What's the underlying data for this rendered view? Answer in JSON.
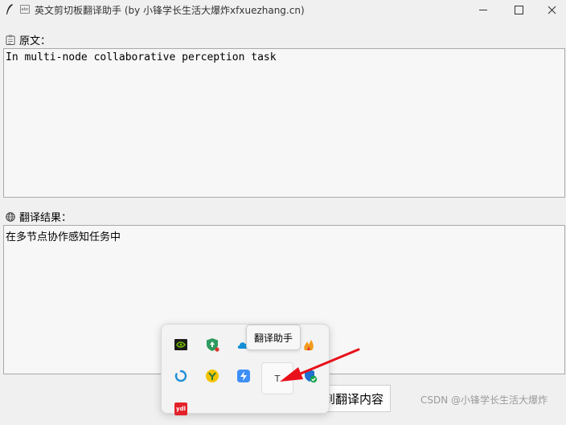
{
  "window": {
    "title": "英文剪切板翻译助手 (by 小锋学长生活大爆炸xfxuezhang.cn)",
    "title_icon_text": "abc"
  },
  "source": {
    "label": "原文：",
    "text": "In multi-node collaborative perception task"
  },
  "result": {
    "label": "翻译结果：",
    "text": "在多节点协作感知任务中"
  },
  "bottom_button": {
    "label": "到翻译内容"
  },
  "tray": {
    "tooltip": "翻译助手",
    "app_icon_letter": "T",
    "badge_text": "ydl"
  },
  "watermark": "CSDN @小锋学长生活大爆炸",
  "colors": {
    "arrow": "#e8101a",
    "nvidia_green": "#76b900",
    "accent_blue": "#1e90ff"
  }
}
